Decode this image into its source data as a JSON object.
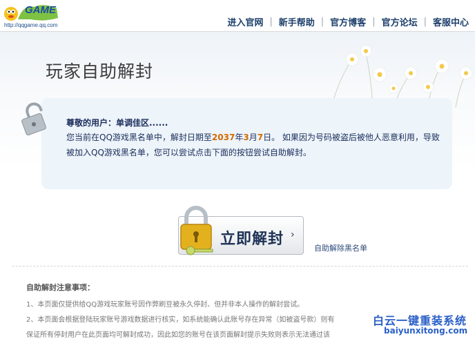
{
  "header": {
    "logo_text": "GAME",
    "logo_url": "http://qqgame.qq.com",
    "nav": [
      "进入官网",
      "新手帮助",
      "官方博客",
      "官方论坛",
      "客服中心"
    ]
  },
  "page": {
    "title": "玩家自助解封"
  },
  "info": {
    "greeting": "尊敬的用户：单调佳区......",
    "msg_part1": "您当前在QQ游戏黑名单中，解封日期至",
    "year": "2037",
    "year_unit": "年",
    "month": "3",
    "month_unit": "月",
    "day": "7",
    "day_unit": "日",
    "msg_part2": "。 如果因为号码被盗后被他人恶意利用，导致被加入QQ游戏黑名单，您可以尝试点击下面的按钮尝试自助解封。"
  },
  "actions": {
    "unlock_label": "立即解封",
    "unlock_arrow": "›",
    "sub_link": "自助解除黑名单"
  },
  "notes": {
    "title": "自助解封注意事项：",
    "items": [
      "1、本页面仅提供给QQ游戏玩家账号因作弊刷豆被永久停封、但并非本人操作的解封尝试。",
      "2、本页面会根据登陆玩家账号游戏数据进行核实，如系统能确认此账号存在异常（如被盗号款）则有",
      "保证所有停封用户在此页面均可解封成功，因此如您的账号在该页面解封提示失败则表示无法通过该"
    ]
  },
  "watermark": {
    "cn": "白云一键重装系统",
    "en": "baiyunxitong.com"
  },
  "colors": {
    "nav_text": "#1d3f6b",
    "highlight": "#d46a00",
    "info_bg": "#edf4fa"
  }
}
